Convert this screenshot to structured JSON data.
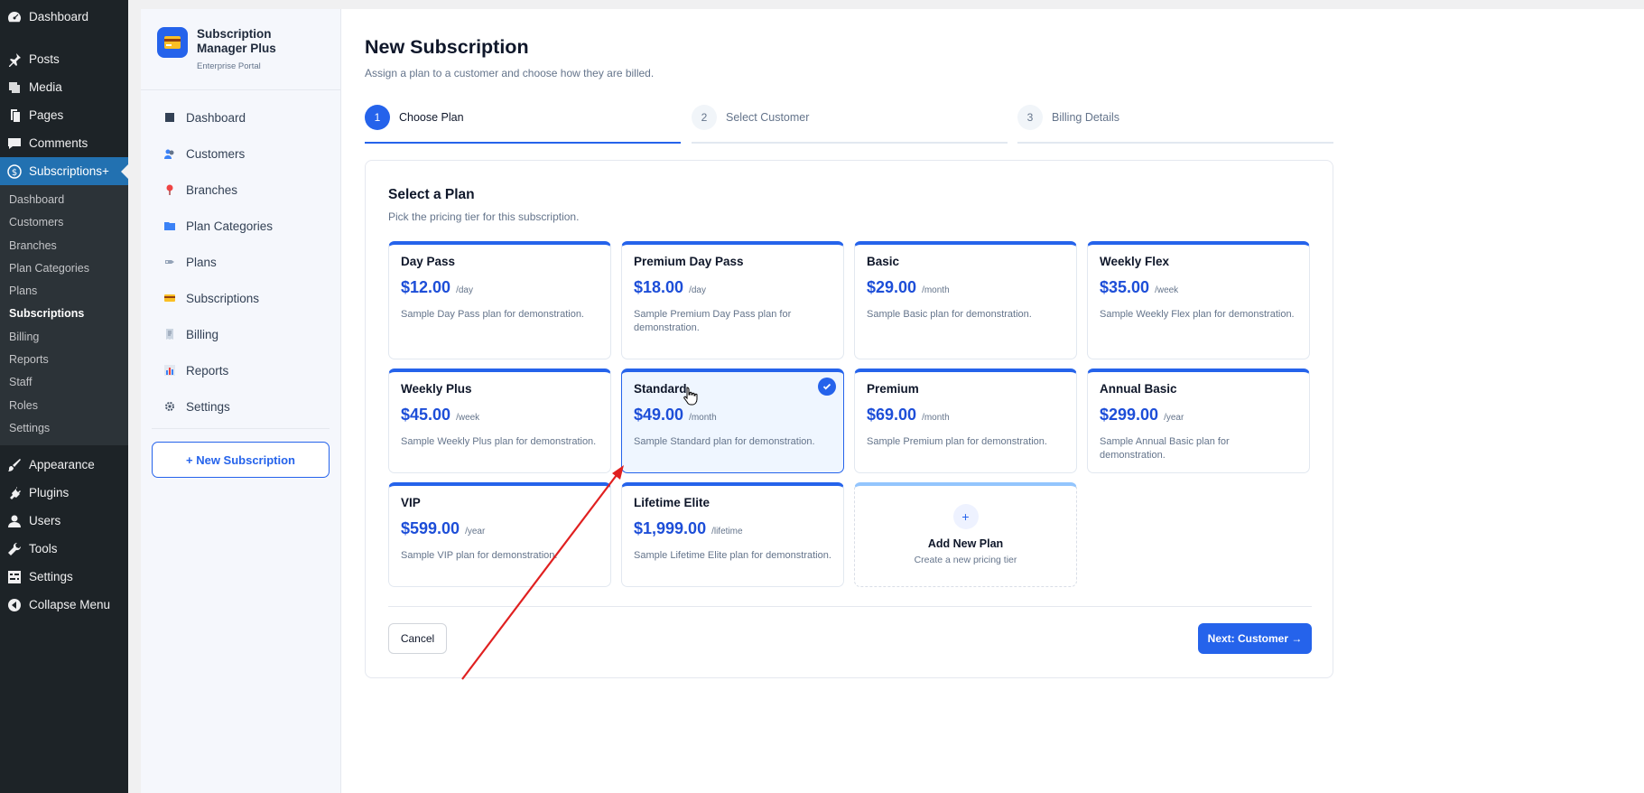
{
  "wp_menu": {
    "top_items": [
      {
        "label": "Dashboard",
        "icon": "gauge-icon"
      },
      {
        "label": "Posts",
        "icon": "pin-icon"
      },
      {
        "label": "Media",
        "icon": "media-icon"
      },
      {
        "label": "Pages",
        "icon": "pages-icon"
      },
      {
        "label": "Comments",
        "icon": "comment-icon"
      },
      {
        "label": "Subscriptions+",
        "icon": "dollar-icon"
      }
    ],
    "sub_items": [
      "Dashboard",
      "Customers",
      "Branches",
      "Plan Categories",
      "Plans",
      "Subscriptions",
      "Billing",
      "Reports",
      "Staff",
      "Roles",
      "Settings"
    ],
    "bottom_items": [
      {
        "label": "Appearance",
        "icon": "brush-icon"
      },
      {
        "label": "Plugins",
        "icon": "plug-icon"
      },
      {
        "label": "Users",
        "icon": "user-icon"
      },
      {
        "label": "Tools",
        "icon": "wrench-icon"
      },
      {
        "label": "Settings",
        "icon": "settings-icon"
      },
      {
        "label": "Collapse Menu",
        "icon": "collapse-icon"
      }
    ]
  },
  "plugin": {
    "name": "Subscription Manager Plus",
    "subtitle": "Enterprise Portal",
    "nav": [
      {
        "label": "Dashboard",
        "icon": "grid-icon"
      },
      {
        "label": "Customers",
        "icon": "people-icon"
      },
      {
        "label": "Branches",
        "icon": "location-pin-icon"
      },
      {
        "label": "Plan Categories",
        "icon": "folder-icon"
      },
      {
        "label": "Plans",
        "icon": "tag-icon"
      },
      {
        "label": "Subscriptions",
        "icon": "card-icon"
      },
      {
        "label": "Billing",
        "icon": "receipt-icon"
      },
      {
        "label": "Reports",
        "icon": "bar-chart-icon"
      },
      {
        "label": "Settings",
        "icon": "gear-icon"
      }
    ],
    "new_button": "+  New Subscription"
  },
  "page": {
    "title": "New Subscription",
    "subtitle": "Assign a plan to a customer and choose how they are billed.",
    "steps": [
      {
        "num": "1",
        "label": "Choose Plan"
      },
      {
        "num": "2",
        "label": "Select Customer"
      },
      {
        "num": "3",
        "label": "Billing Details"
      }
    ]
  },
  "plan_card": {
    "title": "Select a Plan",
    "subtitle": "Pick the pricing tier for this subscription.",
    "plans": [
      {
        "name": "Day Pass",
        "price": "$12.00",
        "period": "/day",
        "desc": "Sample Day Pass plan for demonstration."
      },
      {
        "name": "Premium Day Pass",
        "price": "$18.00",
        "period": "/day",
        "desc": "Sample Premium Day Pass plan for demonstration."
      },
      {
        "name": "Basic",
        "price": "$29.00",
        "period": "/month",
        "desc": "Sample Basic plan for demonstration."
      },
      {
        "name": "Weekly Flex",
        "price": "$35.00",
        "period": "/week",
        "desc": "Sample Weekly Flex plan for demonstration."
      },
      {
        "name": "Weekly Plus",
        "price": "$45.00",
        "period": "/week",
        "desc": "Sample Weekly Plus plan for demonstration."
      },
      {
        "name": "Standard",
        "price": "$49.00",
        "period": "/month",
        "desc": "Sample Standard plan for demonstration."
      },
      {
        "name": "Premium",
        "price": "$69.00",
        "period": "/month",
        "desc": "Sample Premium plan for demonstration."
      },
      {
        "name": "Annual Basic",
        "price": "$299.00",
        "period": "/year",
        "desc": "Sample Annual Basic plan for demonstration."
      },
      {
        "name": "VIP",
        "price": "$599.00",
        "period": "/year",
        "desc": "Sample VIP plan for demonstration."
      },
      {
        "name": "Lifetime Elite",
        "price": "$1,999.00",
        "period": "/lifetime",
        "desc": "Sample Lifetime Elite plan for demonstration."
      }
    ],
    "add_plan": {
      "plus": "+",
      "title": "Add New Plan",
      "subtitle": "Create a new pricing tier"
    },
    "cancel_label": "Cancel",
    "next_label": "Next: Customer →"
  },
  "colors": {
    "accent": "#2563eb",
    "wp_admin": "#1d2327",
    "wp_active": "#2271b1",
    "annotation": "#e02020"
  }
}
